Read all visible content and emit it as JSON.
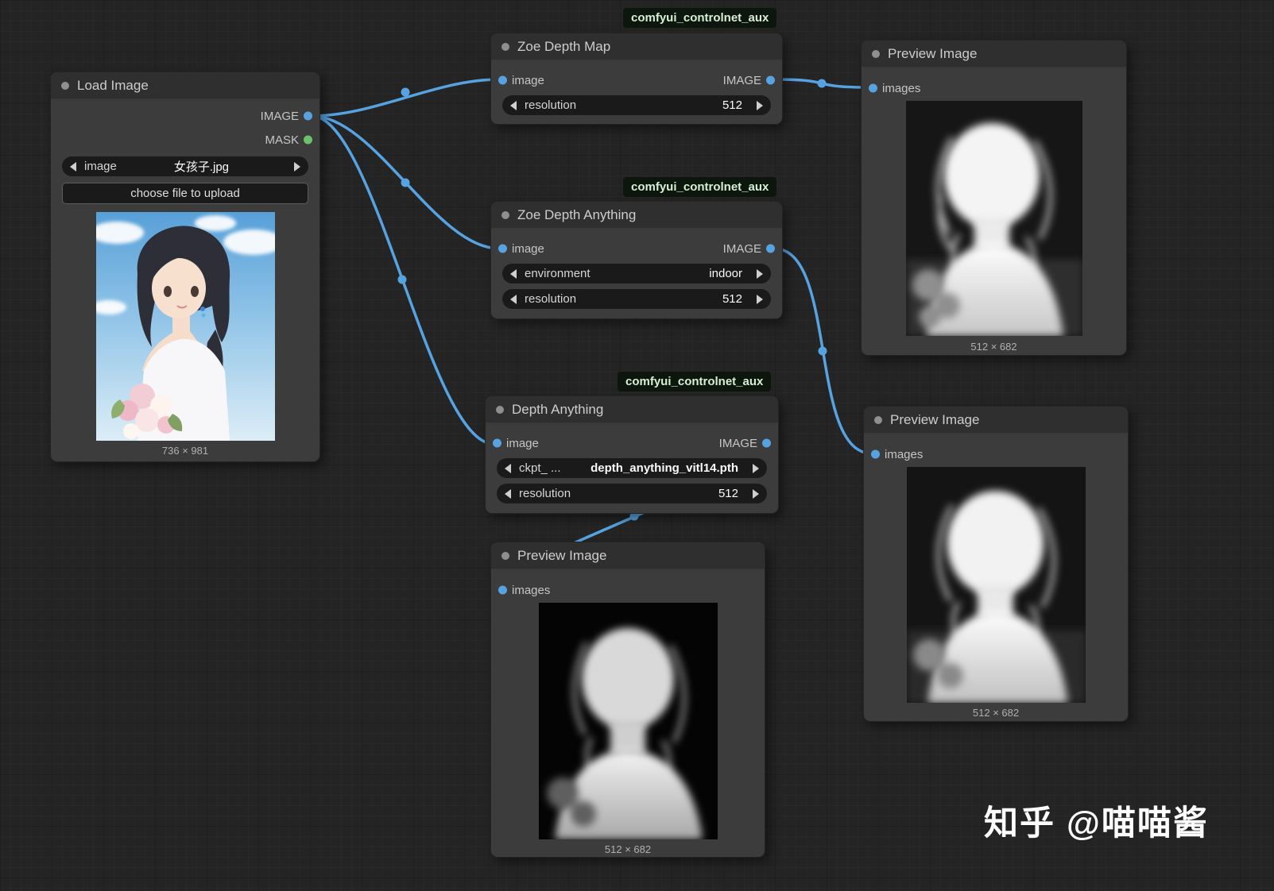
{
  "canvas": {
    "link_color": "#57a3e2",
    "bg_color": "#242424"
  },
  "watermark": "知乎 @喵喵酱",
  "nodes": {
    "load_image": {
      "title": "Load Image",
      "outputs": {
        "image": "IMAGE",
        "mask": "MASK"
      },
      "image_widget": {
        "label": "image",
        "value": "女孩子.jpg"
      },
      "upload_button": "choose file to upload",
      "caption": "736 × 981"
    },
    "zoe_depth_map": {
      "badge": "comfyui_controlnet_aux",
      "title": "Zoe Depth Map",
      "input_label": "image",
      "output_label": "IMAGE",
      "widgets": [
        {
          "label": "resolution",
          "value": "512"
        }
      ]
    },
    "zoe_depth_anything": {
      "badge": "comfyui_controlnet_aux",
      "title": "Zoe Depth Anything",
      "input_label": "image",
      "output_label": "IMAGE",
      "widgets": [
        {
          "label": "environment",
          "value": "indoor"
        },
        {
          "label": "resolution",
          "value": "512"
        }
      ]
    },
    "depth_anything": {
      "badge": "comfyui_controlnet_aux",
      "title": "Depth Anything",
      "input_label": "image",
      "output_label": "IMAGE",
      "widgets": [
        {
          "label": "ckpt_ ...",
          "value": "depth_anything_vitl14.pth"
        },
        {
          "label": "resolution",
          "value": "512"
        }
      ]
    },
    "preview_top_right": {
      "title": "Preview Image",
      "input_label": "images",
      "caption": "512 × 682"
    },
    "preview_bottom_right": {
      "title": "Preview Image",
      "input_label": "images",
      "caption": "512 × 682"
    },
    "preview_bottom_center": {
      "title": "Preview Image",
      "input_label": "images",
      "caption": "512 × 682"
    }
  }
}
